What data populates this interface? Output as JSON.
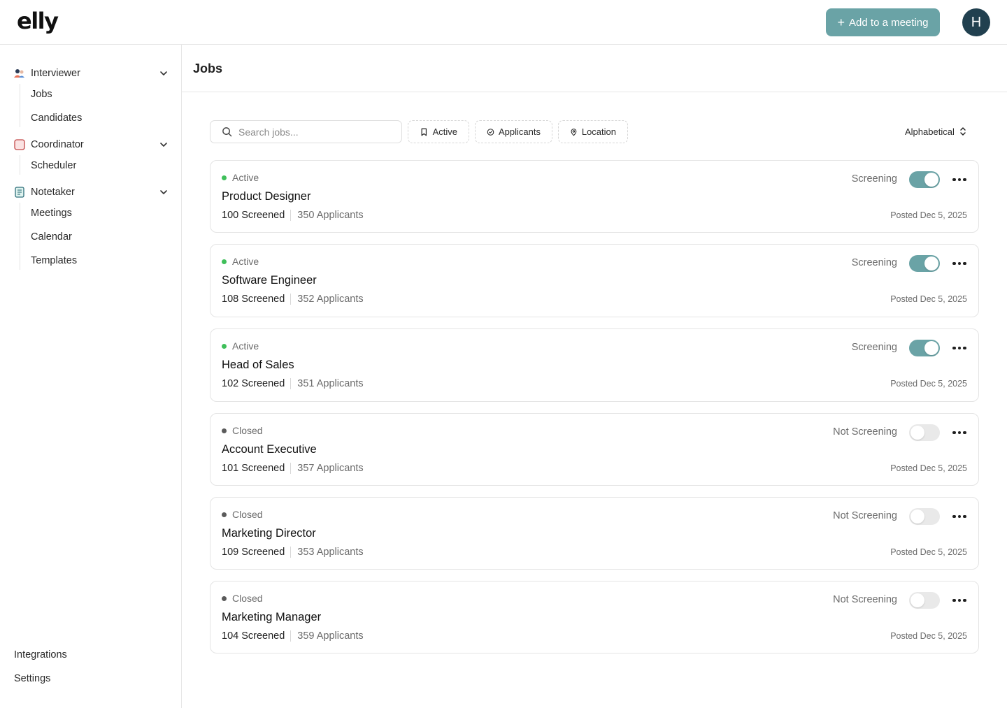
{
  "app": {
    "logo": "elly"
  },
  "header": {
    "add_button": "Add to a meeting",
    "avatar_initial": "H"
  },
  "sidebar": {
    "groups": [
      {
        "label": "Interviewer",
        "items": [
          "Jobs",
          "Candidates"
        ]
      },
      {
        "label": "Coordinator",
        "items": [
          "Scheduler"
        ]
      },
      {
        "label": "Notetaker",
        "items": [
          "Meetings",
          "Calendar",
          "Templates"
        ]
      }
    ],
    "bottom": [
      "Integrations",
      "Settings"
    ]
  },
  "main": {
    "title": "Jobs",
    "search_placeholder": "Search jobs...",
    "filters": [
      "Active",
      "Applicants",
      "Location"
    ],
    "sort": "Alphabetical"
  },
  "jobs": [
    {
      "status": "Active",
      "title": "Product Designer",
      "screened": "100 Screened",
      "applicants": "350 Applicants",
      "screening": "Screening",
      "screening_on": true,
      "posted": "Posted Dec 5, 2025"
    },
    {
      "status": "Active",
      "title": "Software Engineer",
      "screened": "108 Screened",
      "applicants": "352 Applicants",
      "screening": "Screening",
      "screening_on": true,
      "posted": "Posted Dec 5, 2025"
    },
    {
      "status": "Active",
      "title": "Head of Sales",
      "screened": "102 Screened",
      "applicants": "351 Applicants",
      "screening": "Screening",
      "screening_on": true,
      "posted": "Posted Dec 5, 2025"
    },
    {
      "status": "Closed",
      "title": "Account Executive",
      "screened": "101 Screened",
      "applicants": "357 Applicants",
      "screening": "Not Screening",
      "screening_on": false,
      "posted": "Posted Dec 5, 2025"
    },
    {
      "status": "Closed",
      "title": "Marketing Director",
      "screened": "109 Screened",
      "applicants": "353 Applicants",
      "screening": "Not Screening",
      "screening_on": false,
      "posted": "Posted Dec 5, 2025"
    },
    {
      "status": "Closed",
      "title": "Marketing Manager",
      "screened": "104 Screened",
      "applicants": "359 Applicants",
      "screening": "Not Screening",
      "screening_on": false,
      "posted": "Posted Dec 5, 2025"
    }
  ],
  "colors": {
    "accent": "#6aa3a6",
    "avatar": "#21404f",
    "active_dot": "#3fbf5a",
    "closed_dot": "#5b5b5b"
  }
}
